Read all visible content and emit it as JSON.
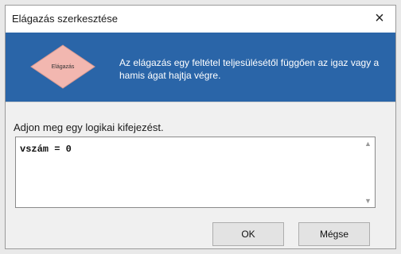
{
  "window": {
    "title": "Elágazás szerkesztése",
    "close_label": "×"
  },
  "banner": {
    "shape_label": "Elágazás",
    "description": "Az elágazás egy feltétel teljesülésétől függően az igaz vagy a hamis ágat hajtja végre.",
    "background_color": "#2a65a8",
    "shape_color": "#f2b7b0"
  },
  "editor": {
    "prompt": "Adjon meg egy logikai kifejezést.",
    "value": "vszám = 0",
    "scroll_up_icon": "chevron-up-icon",
    "scroll_down_icon": "chevron-down-icon"
  },
  "buttons": {
    "ok_label": "OK",
    "cancel_label": "Mégse"
  }
}
